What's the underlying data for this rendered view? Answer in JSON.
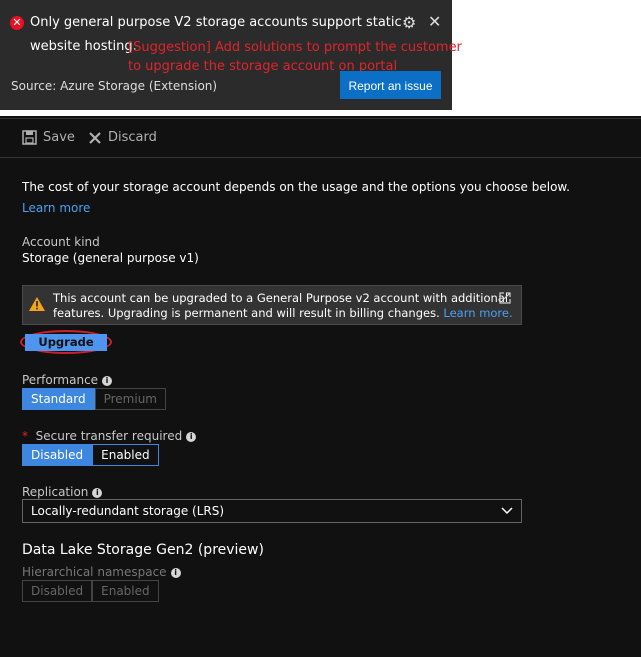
{
  "notification": {
    "message_line1": "Only general purpose V2 storage accounts support static",
    "message_line2": "website hosting.",
    "suggestion_line1": "[Suggestion] Add solutions to prompt the customer",
    "suggestion_line2": "to upgrade the storage account on portal",
    "source": "Source: Azure Storage (Extension)",
    "report_button": "Report an issue"
  },
  "toolbar": {
    "save_label": "Save",
    "discard_label": "Discard"
  },
  "intro": {
    "text": "The cost of your storage account depends on the usage and the options you choose below.",
    "learn_more": "Learn more"
  },
  "account_kind": {
    "label": "Account kind",
    "value": "Storage (general purpose v1)"
  },
  "upgrade_notice": {
    "line1": "This account can be upgraded to a General Purpose v2 account with additional",
    "line2": "features. Upgrading is permanent and will result in billing changes.",
    "learn_more": "Learn more.",
    "button": "Upgrade"
  },
  "performance": {
    "label": "Performance",
    "options": [
      "Standard",
      "Premium"
    ],
    "selected": "Standard"
  },
  "secure_transfer": {
    "required_mark": "*",
    "label": "Secure transfer required",
    "options": [
      "Disabled",
      "Enabled"
    ],
    "selected": "Disabled"
  },
  "replication": {
    "label": "Replication",
    "value": "Locally-redundant storage (LRS)"
  },
  "data_lake": {
    "heading": "Data Lake Storage Gen2 (preview)",
    "label": "Hierarchical namespace",
    "options": [
      "Disabled",
      "Enabled"
    ]
  },
  "colors": {
    "accent": "#3e87e0",
    "error": "#e81123",
    "suggestion": "#e0242a",
    "link": "#4aa1f5",
    "background": "#111111"
  }
}
